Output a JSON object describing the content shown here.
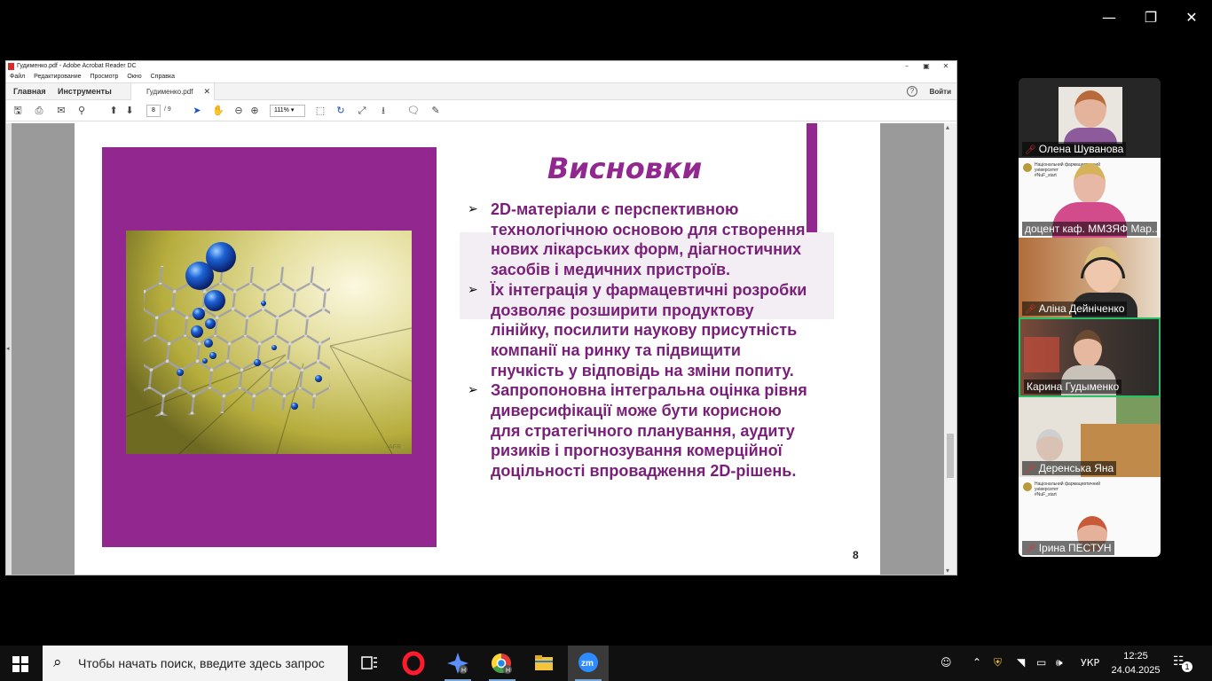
{
  "acrobat": {
    "window_title": "Гудименко.pdf - Adobe Acrobat Reader DC",
    "menu": [
      "Файл",
      "Редактирование",
      "Просмотр",
      "Окно",
      "Справка"
    ],
    "tab_home": "Главная",
    "tab_tools": "Инструменты",
    "doc_tab": "Гудименко.pdf",
    "sign_in": "Войти",
    "page_current": "8",
    "page_total": "/ 9",
    "zoom": "111%"
  },
  "slide": {
    "title": "Висновки",
    "bullets": [
      "2D-матеріали є перспективною технологічною основою для створення нових лікарських форм, діагностичних засобів і медичних пристроїв.",
      "Їх інтеграція у фармацевтичні розробки дозволяє розширити продуктову лінійку, посилити наукову присутність компанії на ринку та підвищити гнучкість у відповідь на зміни попиту.",
      "Запропоновна інтегральна оцінка рівня диверсифікації може бути корисною для стратегічного планування, аудиту ризиків і прогнозування комерційної доцільності впровадження 2D-рішень."
    ],
    "page_number": "8",
    "image_signature": "AFR",
    "accent_color": "#92278f"
  },
  "participants": [
    {
      "name": "Олена Шуванова",
      "muted": true
    },
    {
      "name": "доцент каф. ММЗЯФ Мар...",
      "muted": false,
      "banner_line1": "Національний фармацевтичний",
      "banner_line2": "університет",
      "banner_tag": "#NuF_start"
    },
    {
      "name": "Аліна Дейніченко",
      "muted": true
    },
    {
      "name": "Карина Гудыменко",
      "muted": false,
      "active_speaker": true
    },
    {
      "name": "Деренська Яна",
      "muted": true
    },
    {
      "name": "Ірина ПЕСТУН",
      "muted": true,
      "banner_line1": "Національний фармацевтичний",
      "banner_line2": "університет",
      "banner_tag": "#NuF_start"
    }
  ],
  "taskbar": {
    "search_placeholder": "Чтобы начать поиск, введите здесь запрос",
    "language": "УКР",
    "time": "12:25",
    "date": "24.04.2025",
    "notification_count": "1"
  }
}
